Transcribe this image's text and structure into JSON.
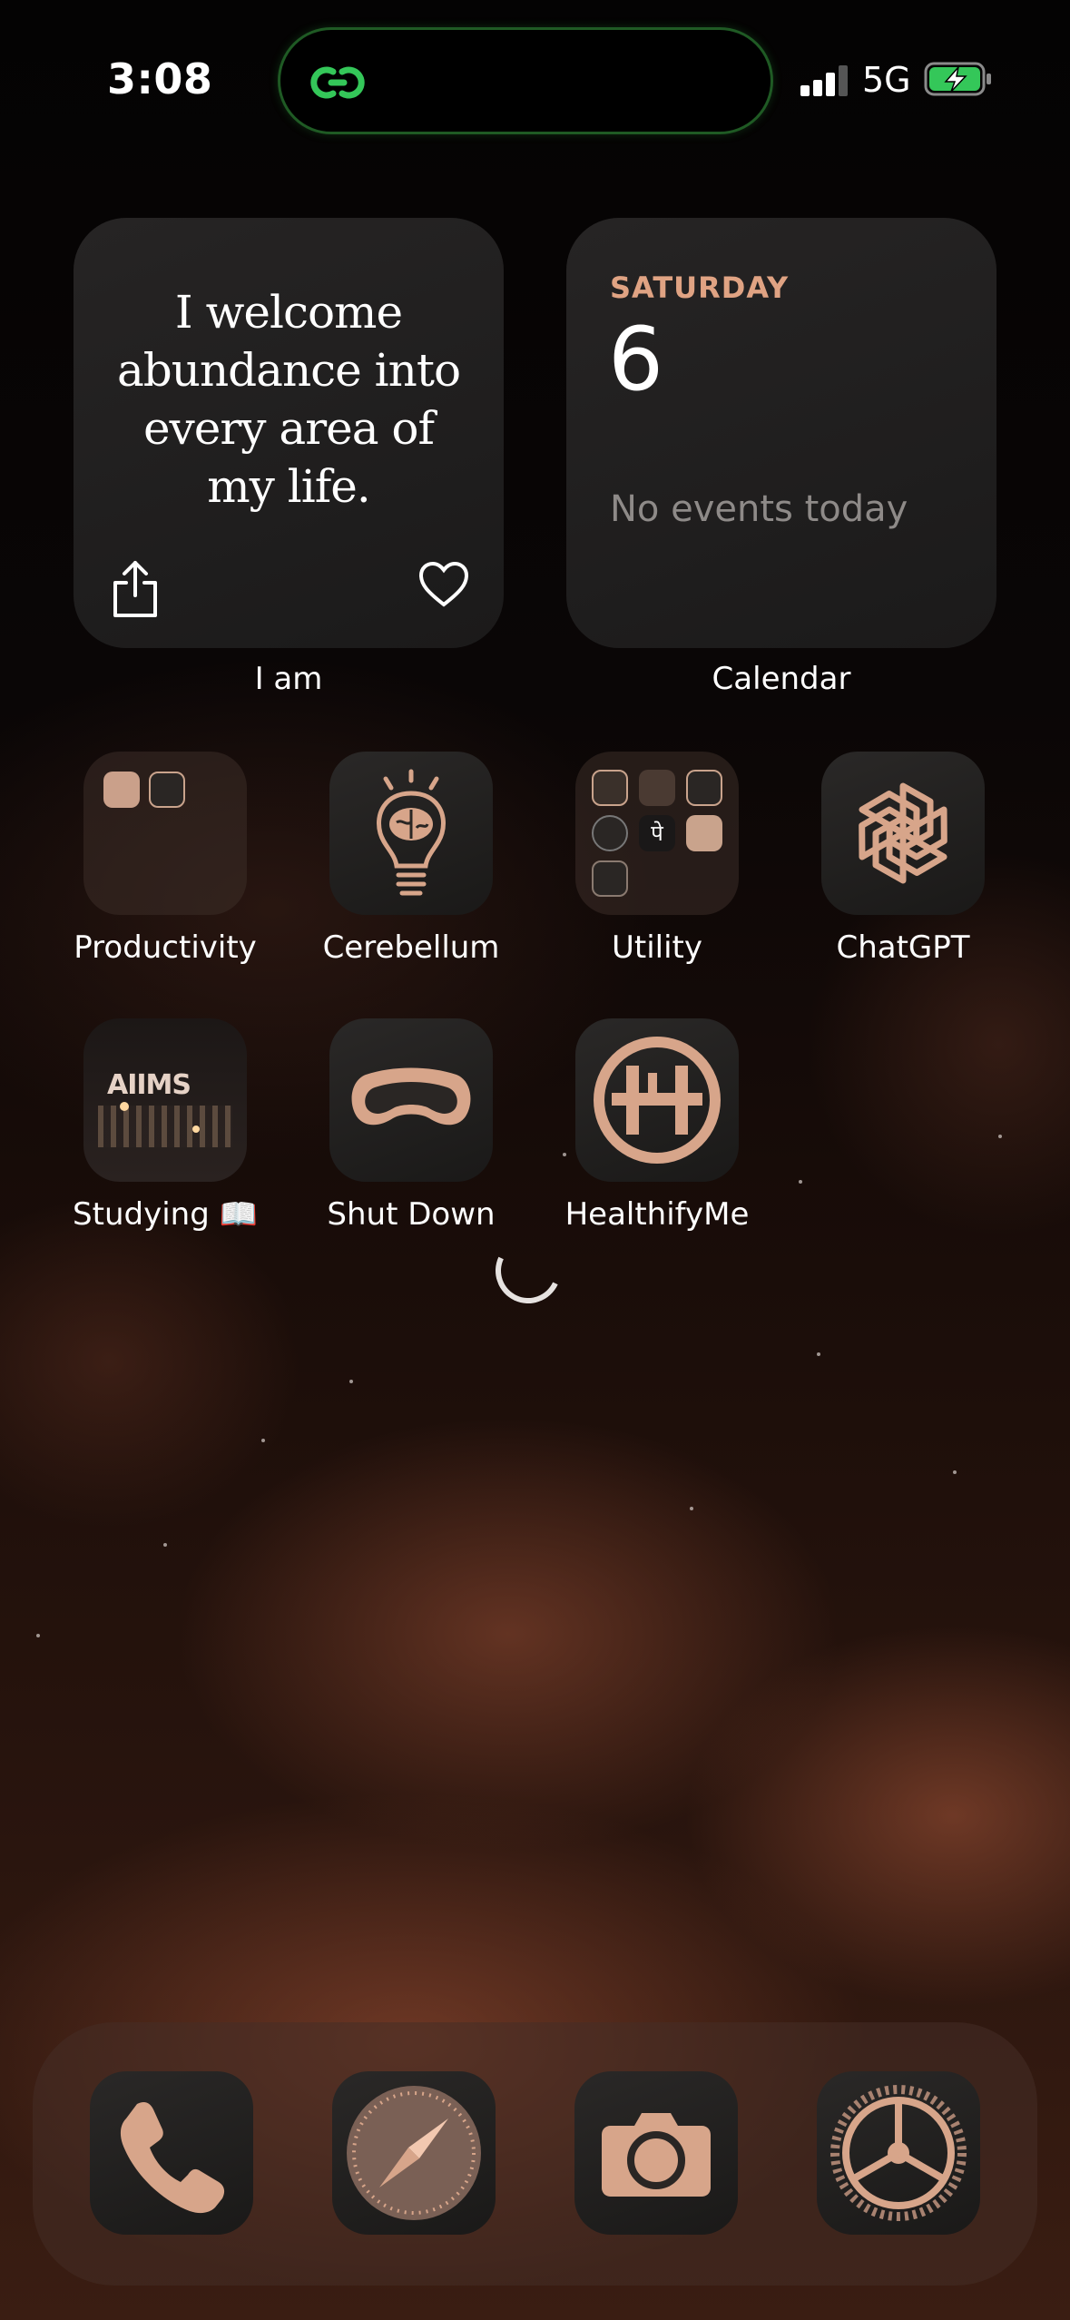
{
  "status_bar": {
    "time": "3:08",
    "network": "5G",
    "island_icon": "chain-link-icon",
    "accent_color": "#34c759"
  },
  "widgets": {
    "affirmation": {
      "quote": "I welcome\nabundance into\nevery area of\nmy life.",
      "label": "I am",
      "share_icon": "share-icon",
      "like_icon": "heart-icon"
    },
    "calendar": {
      "day_name": "SATURDAY",
      "date": "6",
      "events_text": "No events today",
      "label": "Calendar"
    }
  },
  "apps": [
    {
      "label": "Productivity",
      "icon": "folder-icon"
    },
    {
      "label": "Cerebellum",
      "icon": "lightbulb-brain-icon"
    },
    {
      "label": "Utility",
      "icon": "folder-icon"
    },
    {
      "label": "ChatGPT",
      "icon": "openai-knot-icon"
    },
    {
      "label": "Studying 📖",
      "icon": "aiims-building-icon",
      "icon_text": "AIIMS"
    },
    {
      "label": "Shut Down",
      "icon": "sleep-mask-icon"
    },
    {
      "label": "HealthifyMe",
      "icon": "healthifyme-logo-icon"
    }
  ],
  "dock": [
    {
      "name": "Phone",
      "icon": "phone-icon"
    },
    {
      "name": "Safari",
      "icon": "compass-icon"
    },
    {
      "name": "Camera",
      "icon": "camera-icon"
    },
    {
      "name": "Settings",
      "icon": "gear-icon"
    }
  ],
  "theme": {
    "icon_tint": "#d7a58a",
    "calendar_accent": "#e0a383"
  }
}
